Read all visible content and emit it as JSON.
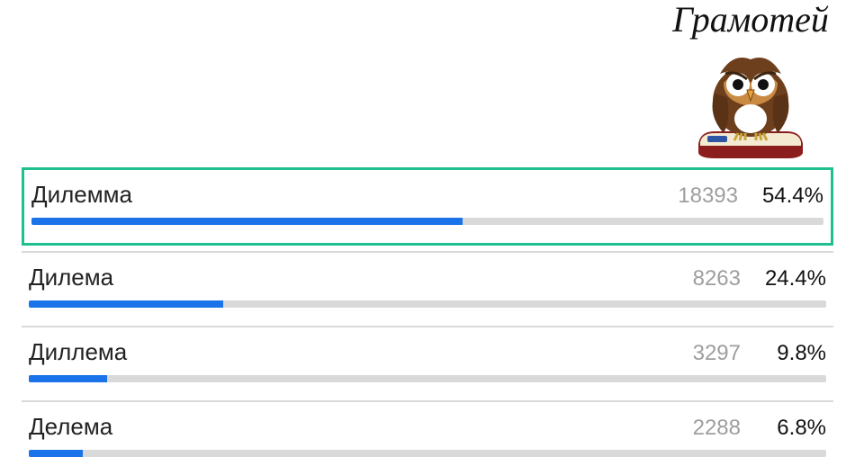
{
  "brand": {
    "title": "Грамотей"
  },
  "chart_data": {
    "type": "bar",
    "title": "",
    "categories": [
      "Дилемма",
      "Дилема",
      "Диллема",
      "Делема"
    ],
    "series": [
      {
        "name": "votes",
        "values": [
          18393,
          8263,
          3297,
          2288
        ]
      },
      {
        "name": "percent",
        "values": [
          54.4,
          24.4,
          9.8,
          6.8
        ]
      }
    ],
    "xlabel": "",
    "ylabel": "",
    "ylim": [
      0,
      100
    ]
  },
  "results": {
    "options": [
      {
        "label": "Дилемма",
        "count": "18393",
        "percent": "54.4%",
        "fill_pct": 54.4,
        "correct": true
      },
      {
        "label": "Дилема",
        "count": "8263",
        "percent": "24.4%",
        "fill_pct": 24.4,
        "correct": false
      },
      {
        "label": "Диллема",
        "count": "3297",
        "percent": "9.8%",
        "fill_pct": 9.8,
        "correct": false
      },
      {
        "label": "Делема",
        "count": "2288",
        "percent": "6.8%",
        "fill_pct": 6.8,
        "correct": false
      }
    ]
  }
}
